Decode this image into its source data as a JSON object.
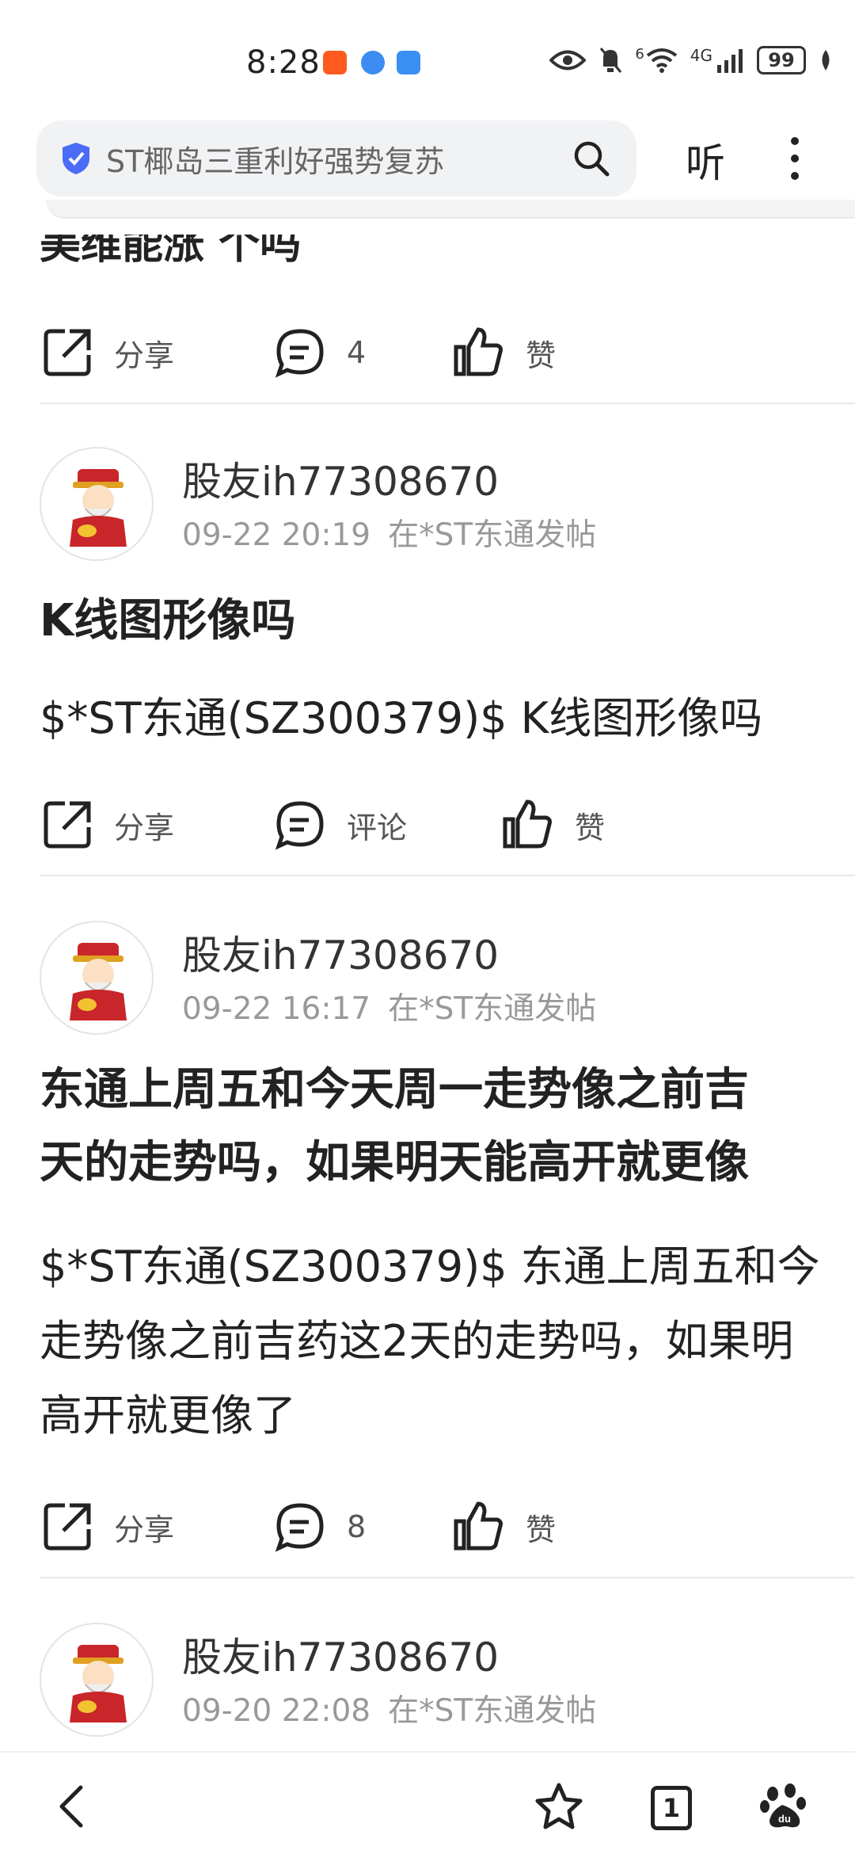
{
  "status_bar": {
    "time": "8:28",
    "battery": "99",
    "network": "4G",
    "wifi_badge": "6"
  },
  "search": {
    "query": "ST椰岛三重利好强势复苏",
    "listen_label": "听"
  },
  "cut_off_text": "美维能涨 个吗",
  "posts": [
    {
      "share_label": "分享",
      "comment_label": "4",
      "like_label": "赞"
    },
    {
      "username": "股友ih77308670",
      "time": "09-22 20:19",
      "source": "在*ST东通发帖",
      "title_lines": [
        "K线图形像吗"
      ],
      "body_lines": [
        "$*ST东通(SZ300379)$ K线图形像吗"
      ],
      "share_label": "分享",
      "comment_label": "评论",
      "like_label": "赞"
    },
    {
      "username": "股友ih77308670",
      "time": "09-22 16:17",
      "source": "在*ST东通发帖",
      "title_lines": [
        "东通上周五和今天周一走势像之前吉",
        "天的走势吗，如果明天能高开就更像"
      ],
      "body_lines": [
        "$*ST东通(SZ300379)$ 东通上周五和今",
        "走势像之前吉药这2天的走势吗，如果明",
        "高开就更像了"
      ],
      "share_label": "分享",
      "comment_label": "8",
      "like_label": "赞"
    },
    {
      "username": "股友ih77308670",
      "time": "09-20 22:08",
      "source": "在*ST东通发帖"
    }
  ],
  "bottom_nav": {
    "tab_count": "1"
  },
  "icons": {
    "shield": "shield-check-icon",
    "search": "search-icon",
    "more": "more-vertical-icon",
    "share": "share-icon",
    "comment": "comment-icon",
    "like": "thumbs-up-icon",
    "back": "back-icon",
    "star": "star-icon",
    "tabs": "tabs-icon",
    "baidu": "baidu-paw-icon"
  },
  "colors": {
    "shield": "#4a6cf7",
    "text": "#222222",
    "meta": "#999999",
    "divider": "#e9e9e9"
  }
}
